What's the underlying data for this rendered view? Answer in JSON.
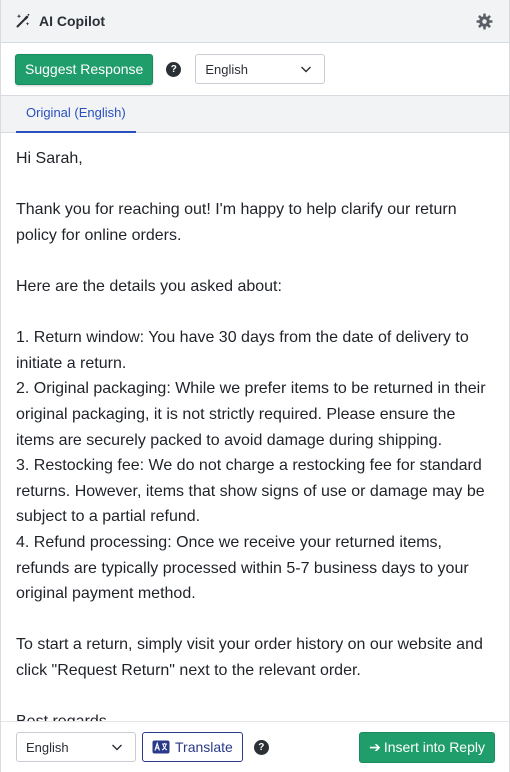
{
  "header": {
    "title": "AI Copilot",
    "icon": "magic-wand-icon",
    "settings_icon": "gear-icon"
  },
  "toolbar": {
    "suggest_label": "Suggest Response",
    "help_glyph": "?",
    "language_selected": "English"
  },
  "tabs": [
    {
      "label": "Original (English)",
      "active": true
    }
  ],
  "message": {
    "text": "Hi Sarah,\n\nThank you for reaching out! I'm happy to help clarify our return policy for online orders.\n\nHere are the details you asked about:\n\n1. Return window: You have 30 days from the date of delivery to initiate a return.\n2. Original packaging: While we prefer items to be returned in their original packaging, it is not strictly required. Please ensure the items are securely packed to avoid damage during shipping.\n3. Restocking fee: We do not charge a restocking fee for standard returns. However, items that show signs of use or damage may be subject to a partial refund.\n4. Refund processing: Once we receive your returned items, refunds are typically processed within 5-7 business days to your original payment method.\n\nTo start a return, simply visit your order history on our website and click \"Request Return\" next to the relevant order.\n\nBest regards,"
  },
  "footer": {
    "language_selected": "English",
    "translate_label": "Translate",
    "help_glyph": "?",
    "insert_label": "Insert into Reply",
    "insert_arrow": "➔"
  },
  "colors": {
    "accent_green": "#1f9d6b",
    "link_blue": "#2a4fbf",
    "translate_navy": "#2a3a8a",
    "header_bg": "#f2f3f5"
  }
}
